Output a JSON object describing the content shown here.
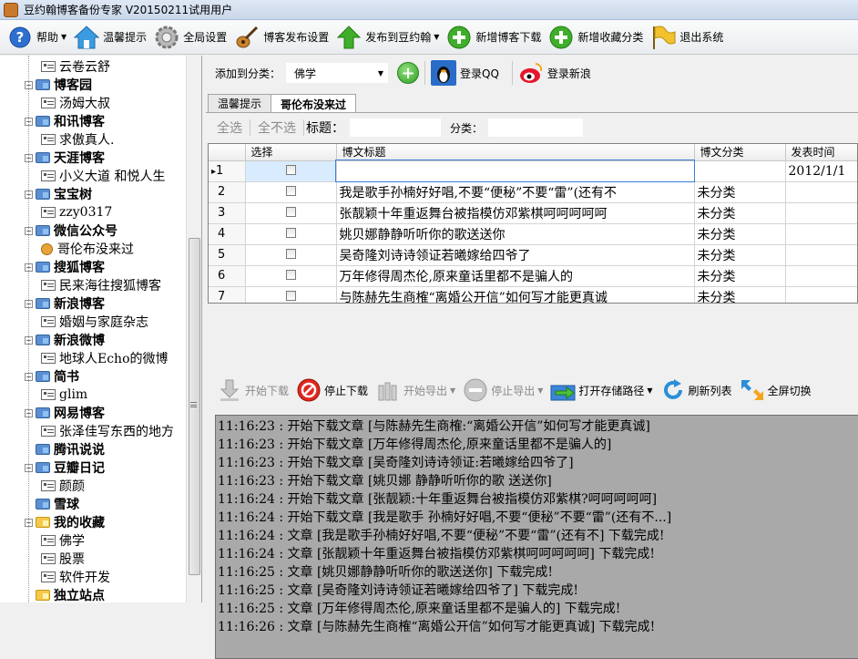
{
  "window": {
    "title": "豆约翰博客备份专家 V20150211试用用户"
  },
  "toolbar": {
    "items": [
      {
        "label": "帮助",
        "icon": "help-icon",
        "has_caret": true
      },
      {
        "label": "温馨提示",
        "icon": "home-icon",
        "has_caret": false
      },
      {
        "label": "全局设置",
        "icon": "gear-icon",
        "has_caret": false
      },
      {
        "label": "博客发布设置",
        "icon": "guitar-icon",
        "has_caret": false
      },
      {
        "label": "发布到豆约翰",
        "icon": "green-up-arrow-icon",
        "has_caret": true
      },
      {
        "label": "新增博客下载",
        "icon": "green-plus-icon",
        "has_caret": false
      },
      {
        "label": "新增收藏分类",
        "icon": "green-plus-icon",
        "has_caret": false
      },
      {
        "label": "退出系统",
        "icon": "yellow-flag-icon",
        "has_caret": false
      }
    ]
  },
  "sidebar": {
    "items": [
      {
        "label": "云卷云舒",
        "type": "leaf",
        "level": 2
      },
      {
        "label": "博客园",
        "type": "folder",
        "level": 1
      },
      {
        "label": "汤姆大叔",
        "type": "leaf",
        "level": 2
      },
      {
        "label": "和讯博客",
        "type": "folder",
        "level": 1
      },
      {
        "label": "求傲真人.",
        "type": "leaf",
        "level": 2
      },
      {
        "label": "天涯博客",
        "type": "folder",
        "level": 1
      },
      {
        "label": "小义大道 和悦人生",
        "type": "leaf",
        "level": 2
      },
      {
        "label": "宝宝树",
        "type": "folder",
        "level": 1
      },
      {
        "label": "zzy0317",
        "type": "leaf",
        "level": 2
      },
      {
        "label": "微信公众号",
        "type": "folder",
        "level": 1
      },
      {
        "label": "哥伦布没来过",
        "type": "qq",
        "level": 2
      },
      {
        "label": "搜狐博客",
        "type": "folder",
        "level": 1
      },
      {
        "label": "民来海往搜狐博客",
        "type": "leaf",
        "level": 2
      },
      {
        "label": "新浪博客",
        "type": "folder",
        "level": 1
      },
      {
        "label": "婚姻与家庭杂志",
        "type": "leaf",
        "level": 2
      },
      {
        "label": "新浪微博",
        "type": "folder",
        "level": 1
      },
      {
        "label": "地球人Echo的微博",
        "type": "leaf",
        "level": 2
      },
      {
        "label": "简书",
        "type": "folder",
        "level": 1
      },
      {
        "label": "glim",
        "type": "leaf",
        "level": 2
      },
      {
        "label": "网易博客",
        "type": "folder",
        "level": 1
      },
      {
        "label": "张泽佳写东西的地方",
        "type": "leaf",
        "level": 2
      },
      {
        "label": "腾讯说说",
        "type": "folder-noexp",
        "level": 1
      },
      {
        "label": "豆瓣日记",
        "type": "folder",
        "level": 1
      },
      {
        "label": "颜颜",
        "type": "leaf",
        "level": 2
      },
      {
        "label": "雪球",
        "type": "folder-noexp",
        "level": 1
      },
      {
        "label": "我的收藏",
        "type": "folder-yellow",
        "level": 1
      },
      {
        "label": "佛学",
        "type": "leaf",
        "level": 2
      },
      {
        "label": "股票",
        "type": "leaf",
        "level": 2
      },
      {
        "label": "软件开发",
        "type": "leaf",
        "level": 2
      },
      {
        "label": "独立站点",
        "type": "folder-yellow-noexp",
        "level": 1
      }
    ]
  },
  "filterbar": {
    "category_label": "添加到分类：",
    "category_value": "佛学",
    "qq_login_label": "登录QQ",
    "sina_login_label": "登录新浪"
  },
  "tabs": [
    {
      "label": "温馨提示",
      "active": false
    },
    {
      "label": "哥伦布没来过",
      "active": true
    }
  ],
  "selectbar": {
    "select_all": "全选",
    "select_none": "全不选",
    "title_label": "标题：",
    "category_label": "分类："
  },
  "grid": {
    "columns": [
      "选择",
      "博文标题",
      "博文分类",
      "发表时间"
    ],
    "rows": [
      {
        "num": "1",
        "title": "",
        "category": "",
        "date": "2012/1/1",
        "current": true
      },
      {
        "num": "2",
        "title": "我是歌手孙楠好好唱,不要“便秘”不要“雷”(还有不",
        "category": "未分类",
        "date": "",
        "current": false
      },
      {
        "num": "3",
        "title": "张靓颖十年重返舞台被指模仿邓紫棋呵呵呵呵呵",
        "category": "未分类",
        "date": "",
        "current": false
      },
      {
        "num": "4",
        "title": "姚贝娜静静听听你的歌送送你",
        "category": "未分类",
        "date": "",
        "current": false
      },
      {
        "num": "5",
        "title": "吴奇隆刘诗诗领证若曦嫁给四爷了",
        "category": "未分类",
        "date": "",
        "current": false
      },
      {
        "num": "6",
        "title": "万年修得周杰伦,原来童话里都不是骗人的",
        "category": "未分类",
        "date": "",
        "current": false
      },
      {
        "num": "7",
        "title": "与陈赫先生商榷“离婚公开信”如何写才能更真诚",
        "category": "未分类",
        "date": "",
        "current": false
      }
    ]
  },
  "actions": [
    {
      "label": "开始下载",
      "icon": "download-arrow-icon",
      "enabled": false,
      "caret": false
    },
    {
      "label": "停止下载",
      "icon": "stop-red-icon",
      "enabled": true,
      "caret": false
    },
    {
      "label": "开始导出",
      "icon": "export-bottles-icon",
      "enabled": false,
      "caret": true
    },
    {
      "label": "停止导出",
      "icon": "stop-gray-icon",
      "enabled": false,
      "caret": true
    },
    {
      "label": "打开存储路径",
      "icon": "open-folder-arrow-icon",
      "enabled": true,
      "caret": true
    },
    {
      "label": "刷新列表",
      "icon": "refresh-icon",
      "enabled": true,
      "caret": false
    },
    {
      "label": "全屏切换",
      "icon": "fullscreen-arrows-icon",
      "enabled": true,
      "caret": false
    }
  ],
  "log": [
    "11:16:23 : 开始下载文章 [与陈赫先生商榷:“离婚公开信”如何写才能更真诚]",
    "11:16:23 : 开始下载文章 [万年修得周杰伦,原来童话里都不是骗人的]",
    "11:16:23 : 开始下载文章 [吴奇隆刘诗诗领证:若曦嫁给四爷了]",
    "11:16:23 : 开始下载文章 [姚贝娜  静静听听你的歌  送送你]",
    "11:16:24 : 开始下载文章 [张靓颖:十年重返舞台被指模仿邓紫棋?呵呵呵呵呵]",
    "11:16:24 : 开始下载文章 [我是歌手  孙楠好好唱,不要“便秘”不要“雷”(还有不...]",
    "11:16:24 : 文章 [我是歌手孙楠好好唱,不要“便秘”不要“雷”(还有不] 下载完成!",
    "11:16:24 : 文章 [张靓颖十年重返舞台被指模仿邓紫棋呵呵呵呵呵] 下载完成!",
    "11:16:25 : 文章 [姚贝娜静静听听你的歌送送你] 下载完成!",
    "11:16:25 : 文章 [吴奇隆刘诗诗领证若曦嫁给四爷了] 下载完成!",
    "11:16:25 : 文章 [万年修得周杰伦,原来童话里都不是骗人的] 下载完成!",
    "11:16:26 : 文章 [与陈赫先生商榷“离婚公开信”如何写才能更真诚] 下载完成!"
  ]
}
